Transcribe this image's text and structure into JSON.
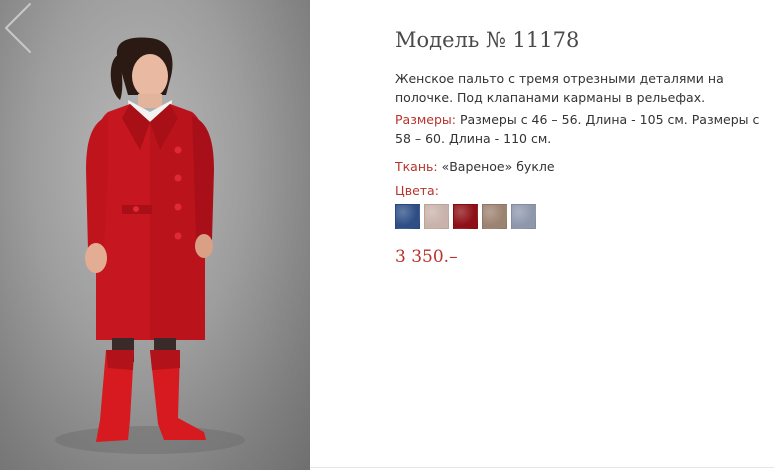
{
  "product": {
    "title": "Модель № 11178",
    "description": "Женское пальто с тремя отрезными деталями на полочке. Под клапанами карманы в рельефах.",
    "sizes_label": "Размеры:",
    "sizes_value": " Размеры с 46 – 56. Длина - 105 см. Размеры с 58 – 60. Длина - 110 см.",
    "fabric_label": "Ткань:",
    "fabric_value": " «Вареное» букле",
    "colors_label": "Цвета:",
    "price": "3 350.–"
  },
  "swatches": [
    {
      "name": "blue",
      "color": "#2e4f86"
    },
    {
      "name": "beige",
      "color": "#c9b2a9"
    },
    {
      "name": "red",
      "color": "#8e1016"
    },
    {
      "name": "tan",
      "color": "#9c8270"
    },
    {
      "name": "grey-blue",
      "color": "#8e98ad"
    }
  ],
  "photo": {
    "arrow_icon": "chevron-left-icon",
    "coat_color": "#c6161f",
    "boots_color": "#d61a1f"
  }
}
